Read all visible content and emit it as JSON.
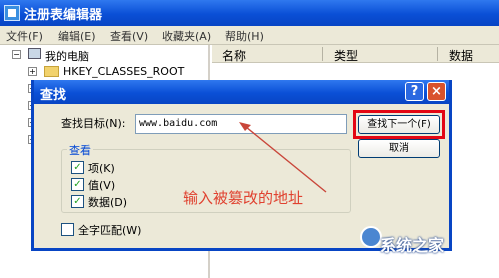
{
  "app": {
    "title": "注册表编辑器"
  },
  "menu": [
    "文件(F)",
    "编辑(E)",
    "查看(V)",
    "收藏夹(A)",
    "帮助(H)"
  ],
  "tree": {
    "root": "我的电脑",
    "first_key": "HKEY_CLASSES_ROOT"
  },
  "list": {
    "columns": [
      "名称",
      "类型",
      "数据"
    ]
  },
  "dialog": {
    "title": "查找",
    "help_icon": "?",
    "close_icon": "×",
    "find_label": "查找目标(N):",
    "find_value": "www.baidu.com",
    "find_next_label": "查找下一个(F)",
    "cancel_label": "取消",
    "look_at_label": "查看",
    "options": [
      {
        "label": "项(K)",
        "checked": true
      },
      {
        "label": "值(V)",
        "checked": true
      },
      {
        "label": "数据(D)",
        "checked": true
      }
    ],
    "whole_match_label": "全字匹配(W)",
    "whole_match_checked": false
  },
  "annotation": {
    "text": "输入被篡改的地址",
    "color": "#e0412f"
  },
  "watermark": {
    "text": "系统之家"
  },
  "colors": {
    "titlebar": "#0a4fd6",
    "dialog_bg": "#ece9d8",
    "highlight": "#e30613"
  }
}
